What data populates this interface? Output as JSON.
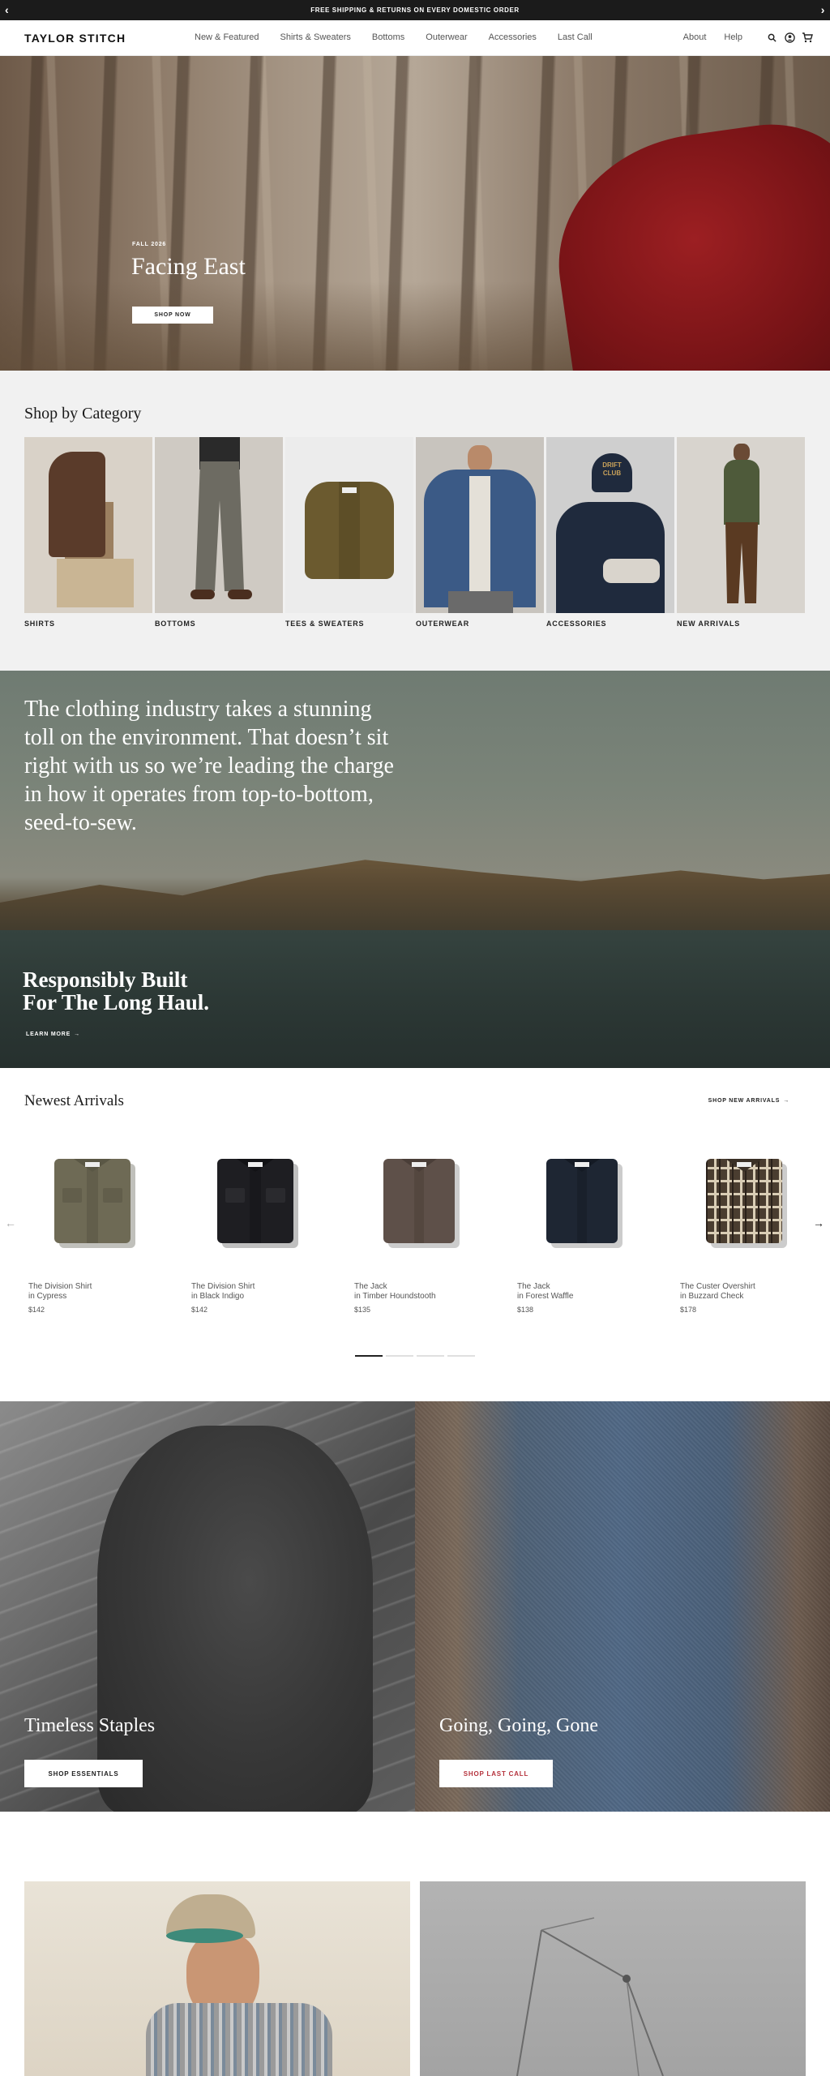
{
  "announcement": {
    "text": "FREE SHIPPING & RETURNS ON EVERY DOMESTIC ORDER"
  },
  "header": {
    "logo": "TAYLOR STITCH",
    "nav": [
      "New & Featured",
      "Shirts & Sweaters",
      "Bottoms",
      "Outerwear",
      "Accessories",
      "Last Call"
    ],
    "right": [
      "About",
      "Help"
    ]
  },
  "hero": {
    "eyebrow": "FALL 2026",
    "title": "Facing East",
    "button": "SHOP NOW"
  },
  "categories": {
    "title": "Shop by Category",
    "items": [
      {
        "label": "SHIRTS",
        "bg": "#d9d2c8",
        "accent": "#5a3b2a"
      },
      {
        "label": "BOTTOMS",
        "bg": "#cfcac3",
        "accent": "#6d6b62"
      },
      {
        "label": "TEES & SWEATERS",
        "bg": "#ececec",
        "accent": "#6b5a2f"
      },
      {
        "label": "OUTERWEAR",
        "bg": "#c8c4be",
        "accent": "#3b5a86"
      },
      {
        "label": "ACCESSORIES",
        "bg": "#cfcfcf",
        "accent": "#1f2a3d"
      },
      {
        "label": "NEW ARRIVALS",
        "bg": "#d8d4ce",
        "accent": "#4e5a3a"
      }
    ]
  },
  "sustainability": {
    "quote": "The clothing industry takes a stunning toll on the environment. That doesn’t sit right with us so we’re leading the charge in how it operates from top-to-bottom, seed-to-sew.",
    "heading_line1": "Responsibly Built",
    "heading_line2": "For The Long Haul.",
    "link": "LEARN MORE"
  },
  "arrivals": {
    "title": "Newest Arrivals",
    "shop_all": "SHOP NEW ARRIVALS",
    "products": [
      {
        "name": "The Division Shirt",
        "variant": "in Cypress",
        "price": "$142",
        "color": "#6e6a55"
      },
      {
        "name": "The Division Shirt",
        "variant": "in Black Indigo",
        "price": "$142",
        "color": "#1e1e22"
      },
      {
        "name": "The Jack",
        "variant": "in Timber Houndstooth",
        "price": "$135",
        "color": "#5e5049"
      },
      {
        "name": "The Jack",
        "variant": "in Forest Waffle",
        "price": "$138",
        "color": "#1e2633"
      },
      {
        "name": "The Custer Overshirt",
        "variant": "in Buzzard Check",
        "price": "$178",
        "color": "#4a3d30"
      }
    ]
  },
  "panels": {
    "left": {
      "title": "Timeless Staples",
      "button": "SHOP ESSENTIALS"
    },
    "right": {
      "title": "Going, Going, Gone",
      "button": "SHOP LAST CALL"
    }
  },
  "colors": {
    "accent_red": "#b5323c",
    "dark": "#1b1b1b"
  }
}
